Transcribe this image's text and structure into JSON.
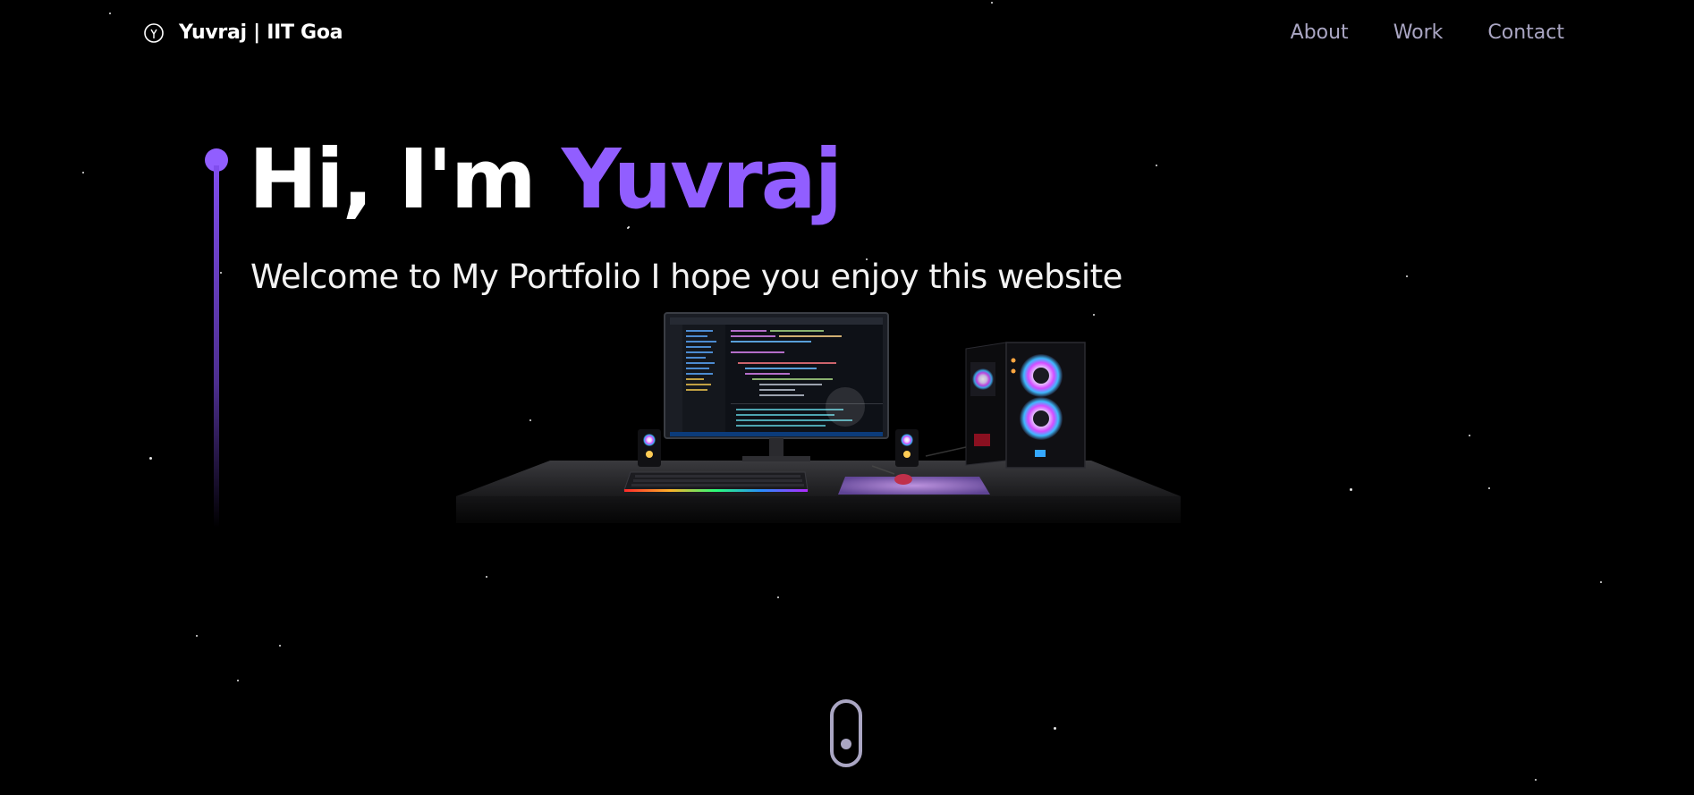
{
  "nav": {
    "brand": "Yuvraj | IIT Goa",
    "links": [
      {
        "label": "About"
      },
      {
        "label": "Work"
      },
      {
        "label": "Contact"
      }
    ]
  },
  "hero": {
    "greeting": "Hi, I'm ",
    "name": "Yuvraj",
    "subtitle": "Welcome to My Portfolio I hope you enjoy this website"
  },
  "colors": {
    "background": "#000000",
    "accent": "#915eff",
    "nav_text": "#aaa6c3",
    "text": "#ffffff"
  },
  "icons": {
    "logo": "logo-icon",
    "scroll": "mouse-scroll-icon"
  }
}
